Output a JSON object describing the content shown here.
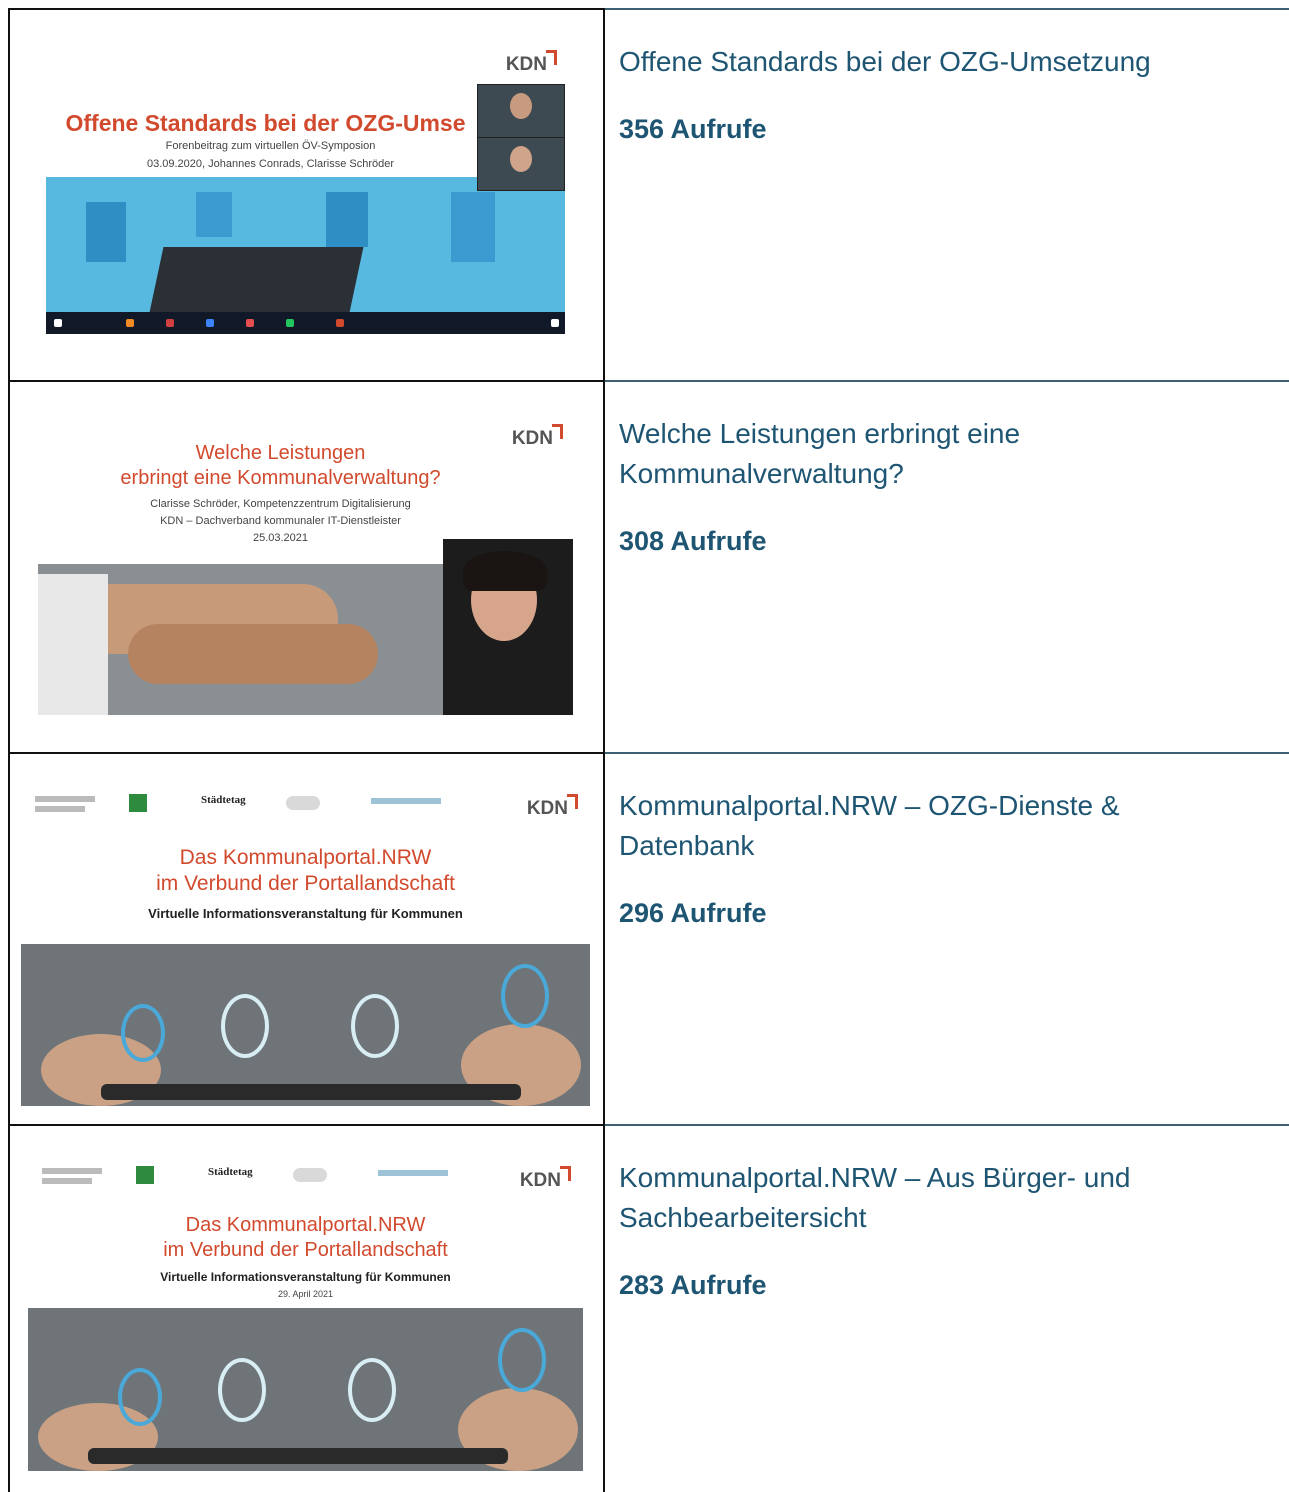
{
  "videos": [
    {
      "title": "Offene Standards bei der OZG-Umsetzung",
      "views": "356 Aufrufe",
      "thumbnail": {
        "brand": "KDN",
        "headline": "Offene Standards bei der OZG-Umse",
        "subtitle": "Forenbeitrag zum virtuellen ÖV-Symposion",
        "byline": "03.09.2020, Johannes Conrads, Clarisse Schröder"
      }
    },
    {
      "title": "Welche Leistungen erbringt eine Kommunalverwaltung?",
      "views": "308 Aufrufe",
      "thumbnail": {
        "brand": "KDN",
        "headline_1": "Welche Leistungen",
        "headline_2": "erbringt eine Kommunalverwaltung?",
        "line_1": "Clarisse Schröder, Kompetenzzentrum Digitalisierung",
        "line_2": "KDN – Dachverband kommunaler IT-Dienstleister",
        "date": "25.03.2021"
      }
    },
    {
      "title": "Kommunalportal.NRW – OZG-Dienste & Datenbank",
      "views": "296 Aufrufe",
      "thumbnail": {
        "brand": "KDN",
        "logo_staedtetag": "Städtetag",
        "headline_1": "Das Kommunalportal.NRW",
        "headline_2": "im Verbund der Portallandschaft",
        "subtitle": "Virtuelle Informationsveranstaltung für Kommunen"
      }
    },
    {
      "title": "Kommunalportal.NRW – Aus Bürger- und Sachbearbeitersicht",
      "views": "283 Aufrufe",
      "thumbnail": {
        "brand": "KDN",
        "logo_staedtetag": "Städtetag",
        "headline_1": "Das Kommunalportal.NRW",
        "headline_2": "im Verbund der Portallandschaft",
        "subtitle": "Virtuelle Informationsveranstaltung für Kommunen",
        "date": "29. April 2021"
      }
    }
  ],
  "colors": {
    "title_text": "#1e5572",
    "row_divider": "#3f5f73",
    "accent_red": "#d24a2d",
    "slide_blue": "#4aa9d8"
  }
}
